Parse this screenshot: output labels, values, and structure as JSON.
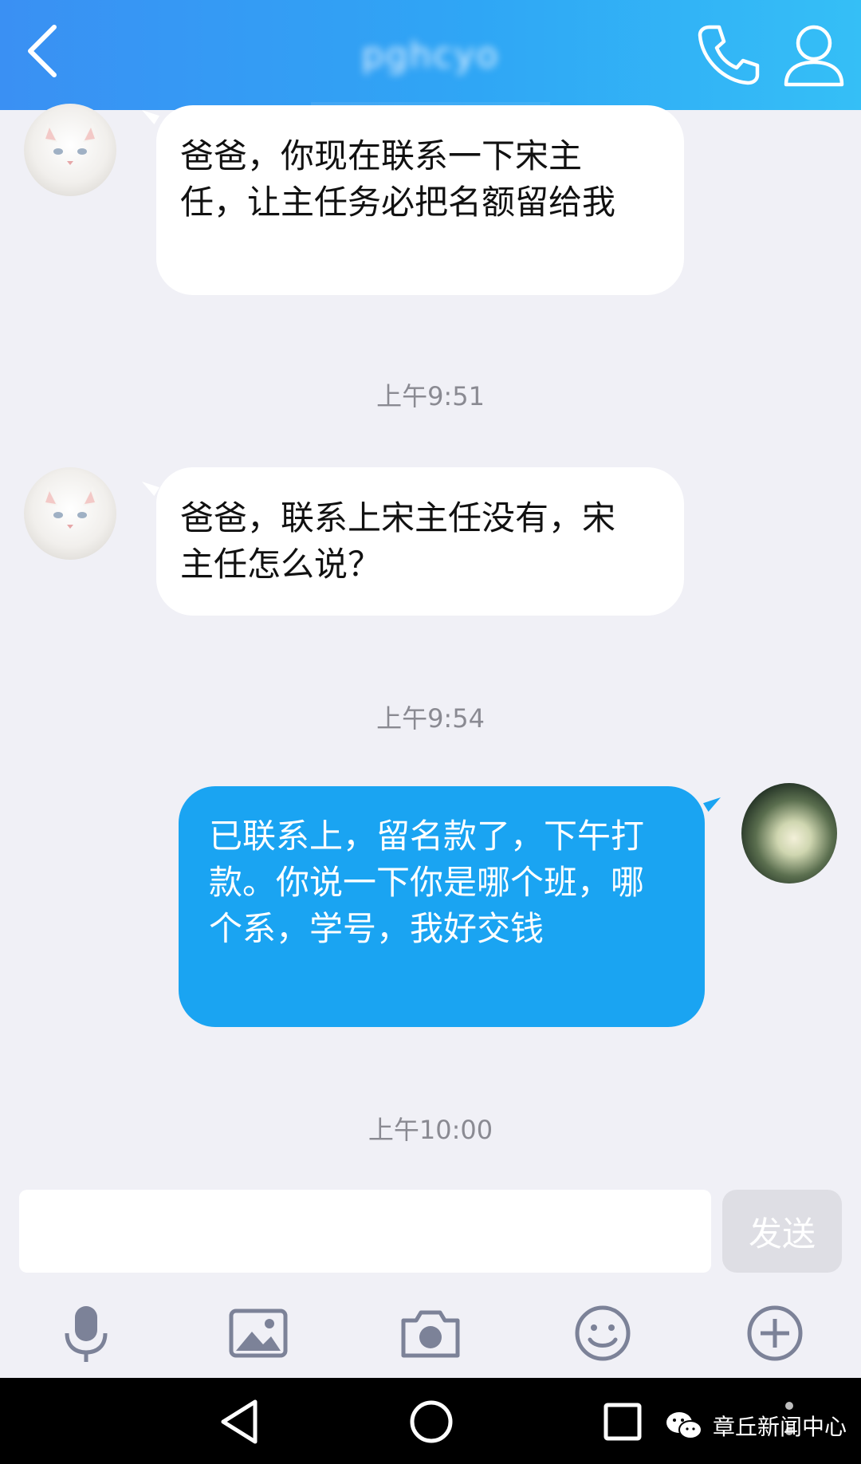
{
  "header": {
    "contact_name": "pghcyo",
    "back_icon": "chevron-left-icon",
    "call_icon": "phone-icon",
    "profile_icon": "user-profile-icon",
    "colors": {
      "gradient_start": "#3a90f3",
      "gradient_end": "#35bff6"
    }
  },
  "messages": [
    {
      "sender": "other",
      "text": "爸爸，你现在联系一下宋主任，让主任务必把名额留给我"
    },
    {
      "timestamp": "上午9:51"
    },
    {
      "sender": "other",
      "text": "爸爸，联系上宋主任没有，宋主任怎么说？"
    },
    {
      "timestamp": "上午9:54"
    },
    {
      "sender": "self",
      "text": "已联系上，留名款了，下午打款。你说一下你是哪个班，哪个系，学号，我好交钱"
    },
    {
      "timestamp": "上午10:00"
    }
  ],
  "input": {
    "value": "",
    "placeholder": "",
    "send_label": "发送"
  },
  "toolbar": [
    "microphone-icon",
    "image-icon",
    "camera-icon",
    "emoji-icon",
    "plus-icon"
  ],
  "navbar": {
    "buttons": [
      "back-triangle-icon",
      "home-circle-icon",
      "recents-square-icon"
    ]
  },
  "watermark": {
    "text": "章丘新闻中心",
    "icon": "wechat-icon"
  },
  "colors": {
    "background": "#f0f0f6",
    "incoming_bubble": "#ffffff",
    "outgoing_bubble": "#1aa4f2",
    "timestamp_text": "#8a8a92"
  }
}
